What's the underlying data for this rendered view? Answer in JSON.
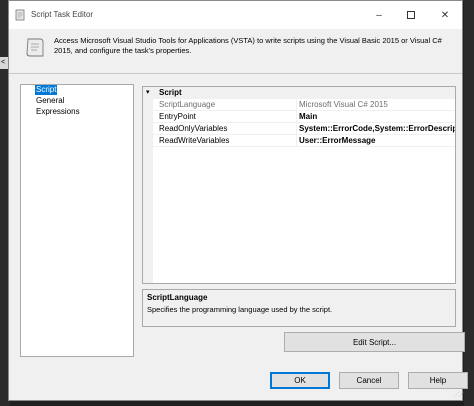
{
  "window": {
    "title": "Script Task Editor",
    "icon": "script-scroll-icon",
    "controls": {
      "minimize": "–",
      "maximize": "max-box",
      "close": "✕"
    }
  },
  "header": {
    "icon": "script-scroll-icon",
    "description": "Access Microsoft Visual Studio Tools for Applications (VSTA) to write scripts using the Visual Basic 2015 or Visual C# 2015, and configure the task's properties."
  },
  "background": {
    "tab_fragment": "<"
  },
  "nav": {
    "items": [
      {
        "label": "Script",
        "selected": true
      },
      {
        "label": "General",
        "selected": false
      },
      {
        "label": "Expressions",
        "selected": false
      }
    ]
  },
  "grid": {
    "category": {
      "toggle": "▾",
      "label": "Script"
    },
    "rows": [
      {
        "name": "ScriptLanguage",
        "value": "Microsoft Visual C# 2015",
        "readonly": true,
        "bold": false
      },
      {
        "name": "EntryPoint",
        "value": "Main",
        "readonly": false,
        "bold": true
      },
      {
        "name": "ReadOnlyVariables",
        "value": "System::ErrorCode,System::ErrorDescription",
        "readonly": false,
        "bold": true
      },
      {
        "name": "ReadWriteVariables",
        "value": "User::ErrorMessage",
        "readonly": false,
        "bold": true
      }
    ]
  },
  "description": {
    "title": "ScriptLanguage",
    "text": "Specifies the programming language used by the script."
  },
  "buttons": {
    "edit_script": "Edit Script...",
    "ok": "OK",
    "cancel": "Cancel",
    "help": "Help"
  },
  "colors": {
    "selection": "#0078d7",
    "window_bg": "#f0f0f0",
    "readonly_text": "#6d6d6d"
  }
}
